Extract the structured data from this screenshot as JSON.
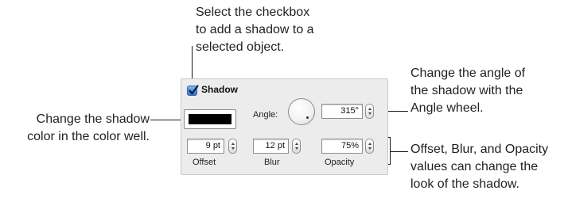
{
  "callouts": {
    "checkbox": [
      "Select the checkbox",
      "to add a shadow to a",
      "selected object."
    ],
    "color": [
      "Change the shadow",
      "color in the color well."
    ],
    "angle": [
      "Change the angle of",
      "the shadow with the",
      "Angle wheel."
    ],
    "values": [
      "Offset, Blur, and Opacity",
      "values can change the",
      "look of the shadow."
    ]
  },
  "panel": {
    "shadow_label": "Shadow",
    "shadow_checked": true,
    "shadow_color": "#000000",
    "angle_label": "Angle:",
    "angle_value": "315°",
    "fields": [
      {
        "value": "9 pt",
        "label": "Offset"
      },
      {
        "value": "12 pt",
        "label": "Blur"
      },
      {
        "value": "75%",
        "label": "Opacity"
      }
    ]
  },
  "icons": {
    "checkbox": "checkmark-icon",
    "stepper": "up-down-arrows-icon"
  }
}
